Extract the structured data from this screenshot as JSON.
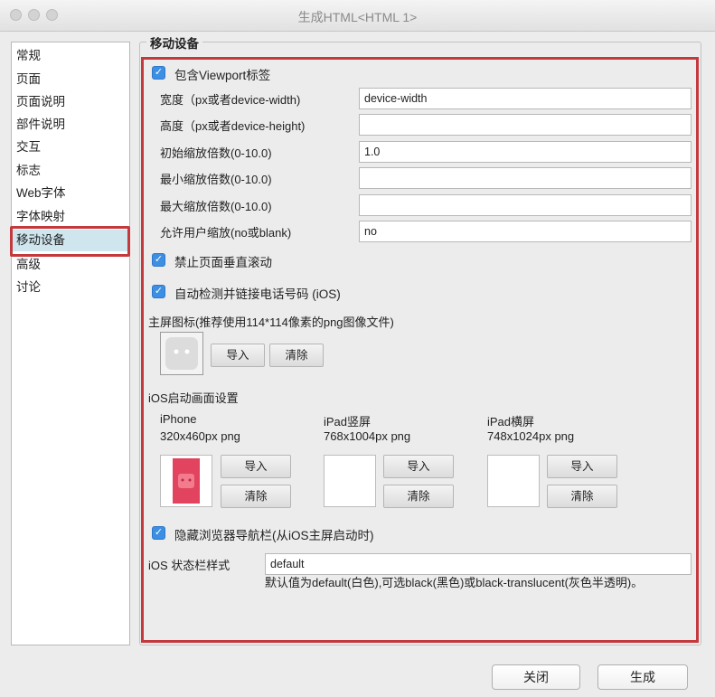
{
  "window": {
    "title": "生成HTML<HTML 1>"
  },
  "sidebar": {
    "items": [
      {
        "label": "常规"
      },
      {
        "label": "页面"
      },
      {
        "label": "页面说明"
      },
      {
        "label": "部件说明"
      },
      {
        "label": "交互"
      },
      {
        "label": "标志"
      },
      {
        "label": "Web字体"
      },
      {
        "label": "字体映射"
      },
      {
        "label": "移动设备"
      },
      {
        "label": "高级"
      },
      {
        "label": "讨论"
      }
    ],
    "selected": "移动设备"
  },
  "group": {
    "title": "移动设备",
    "viewport_checkbox": "包含Viewport标签",
    "fields": [
      {
        "label": "宽度（px或者device-width)",
        "value": "device-width"
      },
      {
        "label": "高度（px或者device-height)",
        "value": ""
      },
      {
        "label": "初始缩放倍数(0-10.0)",
        "value": "1.0"
      },
      {
        "label": "最小缩放倍数(0-10.0)",
        "value": ""
      },
      {
        "label": "最大缩放倍数(0-10.0)",
        "value": ""
      },
      {
        "label": "允许用户缩放(no或blank)",
        "value": "no"
      }
    ],
    "disable_scroll": "禁止页面垂直滚动",
    "auto_detect_phone": "自动检测并链接电话号码 (iOS)",
    "home_icon_label": "主屏图标(推荐使用114*114像素的png图像文件)",
    "import": "导入",
    "clear": "清除",
    "splash_title": "iOS启动画面设置",
    "splash": [
      {
        "device": "iPhone",
        "size": "320x460px png"
      },
      {
        "device": "iPad竖屏",
        "size": "768x1004px png"
      },
      {
        "device": "iPad横屏",
        "size": "748x1024px png"
      }
    ],
    "hide_nav": "隐藏浏览器导航栏(从iOS主屏启动时)",
    "status_bar_label": "iOS 状态栏样式",
    "status_bar_value": "default",
    "status_bar_note": "默认值为default(白色),可选black(黑色)或black-translucent(灰色半透明)。"
  },
  "footer": {
    "close": "关闭",
    "generate": "生成"
  },
  "colors": {
    "accent": "#3c8fe3",
    "highlight": "#c4393d",
    "selected_bg": "#cfe6ee"
  }
}
